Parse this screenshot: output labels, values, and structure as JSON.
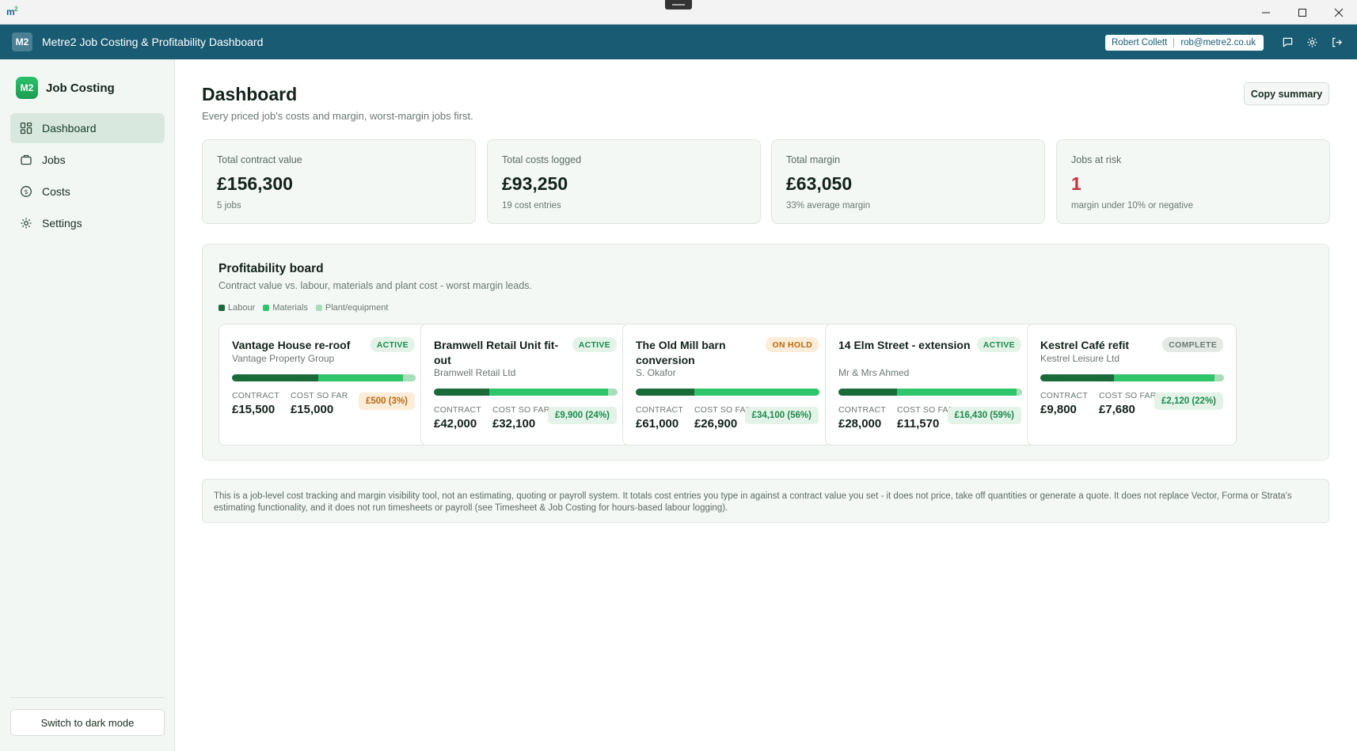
{
  "titlebar": {
    "logo": "m",
    "logo_sup": "2"
  },
  "appbar": {
    "badge": "M2",
    "title": "Metre2 Job Costing & Profitability Dashboard",
    "user_name": "Robert Collett",
    "user_email": "rob@metre2.co.uk"
  },
  "sidebar": {
    "brand_badge": "M2",
    "brand_name": "Job Costing",
    "items": [
      {
        "label": "Dashboard",
        "icon": "dashboard-grid-icon",
        "active": true
      },
      {
        "label": "Jobs",
        "icon": "briefcase-icon",
        "active": false
      },
      {
        "label": "Costs",
        "icon": "pound-coin-icon",
        "active": false
      },
      {
        "label": "Settings",
        "icon": "gear-icon",
        "active": false
      }
    ],
    "dark_mode_label": "Switch to dark mode"
  },
  "main": {
    "title": "Dashboard",
    "subtitle": "Every priced job's costs and margin, worst-margin jobs first.",
    "copy_label": "Copy summary"
  },
  "stats": [
    {
      "label": "Total contract value",
      "value": "£156,300",
      "note": "5 jobs"
    },
    {
      "label": "Total costs logged",
      "value": "£93,250",
      "note": "19 cost entries"
    },
    {
      "label": "Total margin",
      "value": "£63,050",
      "note": "33% average margin"
    },
    {
      "label": "Jobs at risk",
      "value": "1",
      "note": "margin under 10% or negative"
    }
  ],
  "board": {
    "title": "Profitability board",
    "subtitle": "Contract value vs. labour, materials and plant cost - worst margin leads.",
    "legend": [
      {
        "label": "Labour",
        "color": "#1b6b3a"
      },
      {
        "label": "Materials",
        "color": "#2fc56a"
      },
      {
        "label": "Plant/equipment",
        "color": "#a6dfb9"
      }
    ],
    "contract_label": "CONTRACT",
    "cost_label": "COST SO FAR",
    "jobs": [
      {
        "name": "Vantage House re-roof",
        "client": "Vantage Property Group",
        "status": "ACTIVE",
        "contract": "£15,500",
        "cost": "£15,000",
        "margin": "£500 (3%)",
        "split": [
          0.47,
          0.46,
          0.07
        ]
      },
      {
        "name": "Bramwell Retail Unit fit-out",
        "client": "Bramwell Retail Ltd",
        "status": "ACTIVE",
        "contract": "£42,000",
        "cost": "£32,100",
        "margin": "£9,900 (24%)",
        "split": [
          0.3,
          0.65,
          0.05
        ]
      },
      {
        "name": "The Old Mill barn conversion",
        "client": "S. Okafor",
        "status": "ON HOLD",
        "contract": "£61,000",
        "cost": "£26,900",
        "margin": "£34,100 (56%)",
        "split": [
          0.32,
          0.68,
          0.0
        ]
      },
      {
        "name": "14 Elm Street - extension",
        "client": "Mr & Mrs Ahmed",
        "status": "ACTIVE",
        "contract": "£28,000",
        "cost": "£11,570",
        "margin": "£16,430 (59%)",
        "split": [
          0.32,
          0.65,
          0.03
        ]
      },
      {
        "name": "Kestrel Café refit",
        "client": "Kestrel Leisure Ltd",
        "status": "COMPLETE",
        "contract": "£9,800",
        "cost": "£7,680",
        "margin": "£2,120 (22%)",
        "split": [
          0.4,
          0.55,
          0.05
        ]
      }
    ]
  },
  "disclaimer": "This is a job-level cost tracking and margin visibility tool, not an estimating, quoting or payroll system. It totals cost entries you type in against a contract value you set - it does not price, take off quantities or generate a quote. It does not replace Vector, Forma or Strata's estimating functionality, and it does not run timesheets or payroll (see Timesheet & Job Costing for hours-based labour logging)."
}
